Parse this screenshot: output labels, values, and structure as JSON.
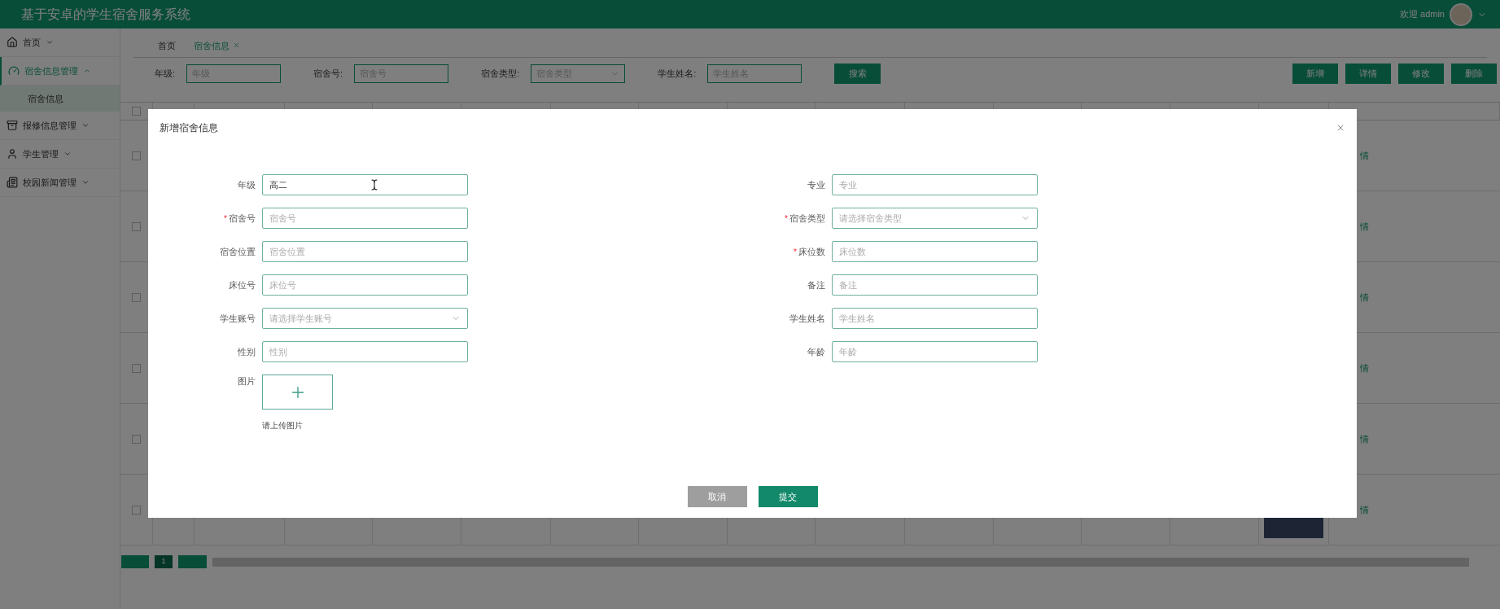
{
  "header": {
    "title": "基于安卓的学生宿舍服务系统",
    "greeting": "欢迎 admin"
  },
  "sidebar": {
    "items": [
      {
        "label": "首页",
        "expanded": false,
        "selected": false
      },
      {
        "label": "宿舍信息管理",
        "expanded": true,
        "selected": true,
        "children": [
          {
            "label": "宿舍信息",
            "selected": true
          }
        ]
      },
      {
        "label": "报修信息管理",
        "expanded": false,
        "selected": false
      },
      {
        "label": "学生管理",
        "expanded": false,
        "selected": false
      },
      {
        "label": "校园新闻管理",
        "expanded": false,
        "selected": false
      }
    ]
  },
  "tabs": [
    {
      "label": "首页",
      "selected": false,
      "closable": false
    },
    {
      "label": "宿舍信息",
      "selected": true,
      "closable": true
    }
  ],
  "filters": [
    {
      "label": "年级:",
      "placeholder": "年级",
      "kind": "text"
    },
    {
      "label": "宿舍号:",
      "placeholder": "宿舍号",
      "kind": "text"
    },
    {
      "label": "宿舍类型:",
      "placeholder": "宿舍类型",
      "kind": "select"
    },
    {
      "label": "学生姓名:",
      "placeholder": "学生姓名",
      "kind": "text"
    }
  ],
  "search_button": "搜索",
  "actions": [
    "新增",
    "详情",
    "修改",
    "删除"
  ],
  "table": {
    "header_checked": false,
    "rows": [
      {
        "checked": false,
        "link": "情"
      },
      {
        "checked": false,
        "link": "情"
      },
      {
        "checked": false,
        "link": "情"
      },
      {
        "checked": false,
        "link": "情"
      },
      {
        "checked": false,
        "link": "情"
      },
      {
        "checked": false,
        "link": "情"
      }
    ]
  },
  "pagination": {
    "pages": [
      {
        "label": "1",
        "selected": true
      }
    ]
  },
  "modal": {
    "title": "新增宿舍信息",
    "required_mark": "*",
    "left": [
      {
        "label": "年级",
        "required": false,
        "kind": "text",
        "value": "高二"
      },
      {
        "label": "宿舍号",
        "required": true,
        "kind": "text",
        "placeholder": "宿舍号"
      },
      {
        "label": "宿舍位置",
        "required": false,
        "kind": "text",
        "placeholder": "宿舍位置"
      },
      {
        "label": "床位号",
        "required": false,
        "kind": "text",
        "placeholder": "床位号"
      },
      {
        "label": "学生账号",
        "required": false,
        "kind": "select",
        "placeholder": "请选择学生账号"
      },
      {
        "label": "性别",
        "required": false,
        "kind": "text",
        "placeholder": "性别"
      }
    ],
    "right": [
      {
        "label": "专业",
        "required": false,
        "kind": "text",
        "placeholder": "专业"
      },
      {
        "label": "宿舍类型",
        "required": true,
        "kind": "select",
        "placeholder": "请选择宿舍类型"
      },
      {
        "label": "床位数",
        "required": true,
        "kind": "text",
        "placeholder": "床位数"
      },
      {
        "label": "备注",
        "required": false,
        "kind": "text",
        "placeholder": "备注"
      },
      {
        "label": "学生姓名",
        "required": false,
        "kind": "text",
        "placeholder": "学生姓名"
      },
      {
        "label": "年龄",
        "required": false,
        "kind": "text",
        "placeholder": "年龄"
      }
    ],
    "upload": {
      "label": "图片",
      "hint": "请上传图片"
    },
    "buttons": [
      {
        "label": "取消",
        "kind": "cancel"
      },
      {
        "label": "提交",
        "kind": "submit"
      }
    ]
  }
}
